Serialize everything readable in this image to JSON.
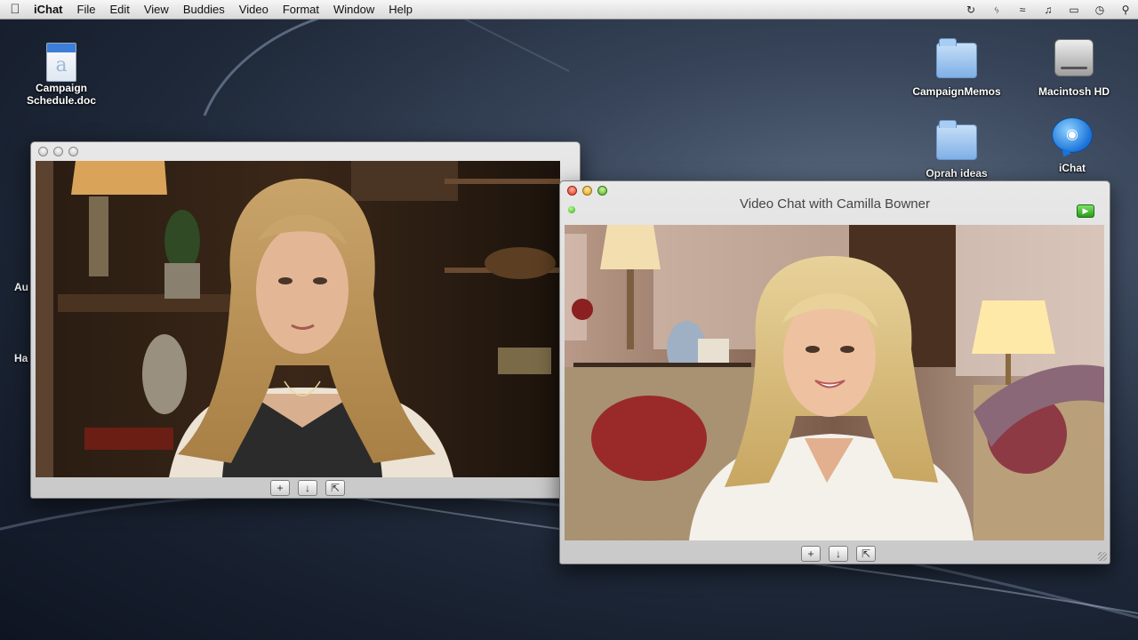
{
  "menubar": {
    "apple_icon": "apple-icon",
    "app_name": "iChat",
    "menus": [
      "File",
      "Edit",
      "View",
      "Buddies",
      "Video",
      "Format",
      "Window",
      "Help"
    ],
    "status_icons": [
      "time-machine-icon",
      "bluetooth-icon",
      "wifi-icon",
      "volume-icon",
      "battery-icon",
      "clock-icon",
      "spotlight-icon"
    ]
  },
  "desktop": {
    "icons": [
      {
        "label": "Campaign\nSchedule.doc",
        "icon": "document-icon"
      },
      {
        "label": "CampaignMemos",
        "icon": "folder-icon"
      },
      {
        "label": "Macintosh HD",
        "icon": "hard-drive-icon"
      },
      {
        "label": "Oprah ideas",
        "icon": "folder-icon"
      },
      {
        "label": "iChat",
        "icon": "ichat-icon"
      }
    ],
    "partial_labels": [
      "Au",
      "Ha"
    ]
  },
  "local_window": {
    "controls": [
      "+",
      "mute",
      "fullscreen"
    ]
  },
  "remote_window": {
    "title": "Video Chat with Camilla Bowner",
    "controls": [
      "+",
      "mute",
      "fullscreen"
    ]
  },
  "colors": {
    "title_text": "#444444",
    "close": "#d9321c",
    "minimize": "#dba11b",
    "zoom": "#55a828"
  }
}
